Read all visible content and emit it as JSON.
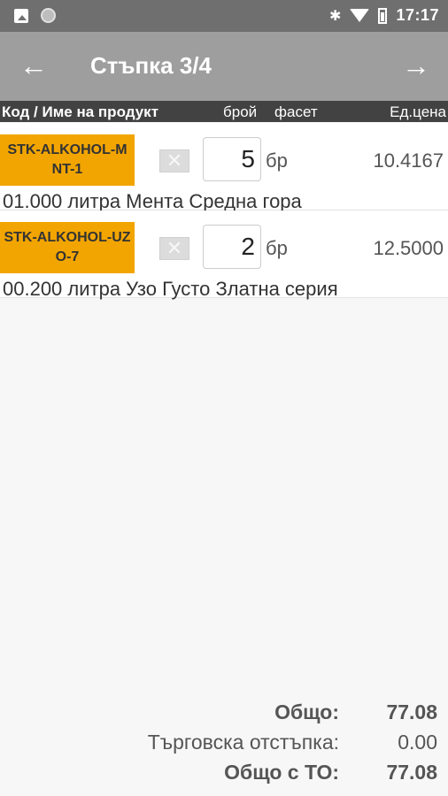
{
  "status_bar": {
    "time": "17:17"
  },
  "app_bar": {
    "title": "Стъпка 3/4",
    "back_icon": "arrow-left-icon",
    "next_icon": "arrow-right-icon"
  },
  "table": {
    "headers": {
      "code": "Код / Име на продукт",
      "qty": "брой",
      "facet": "фасет",
      "price": "Ед.цена"
    },
    "rows": [
      {
        "code": "STK-ALKOHOL-MNT-1",
        "qty": "5",
        "unit": "бр",
        "price": "10.4167",
        "name": "01.000 литра Мента Средна гора"
      },
      {
        "code": "STK-ALKOHOL-UZO-7",
        "qty": "2",
        "unit": "бр",
        "price": "12.5000",
        "name": "00.200 литра Узо Густо Златна серия"
      }
    ]
  },
  "totals": {
    "total_label": "Общо:",
    "total_value": "77.08",
    "discount_label": "Търговска отстъпка:",
    "discount_value": "0.00",
    "total_with_discount_label": "Общо с ТО:",
    "total_with_discount_value": "77.08"
  },
  "colors": {
    "code_badge": "#f2a500",
    "app_bar": "#9e9e9e",
    "header": "#424242"
  }
}
